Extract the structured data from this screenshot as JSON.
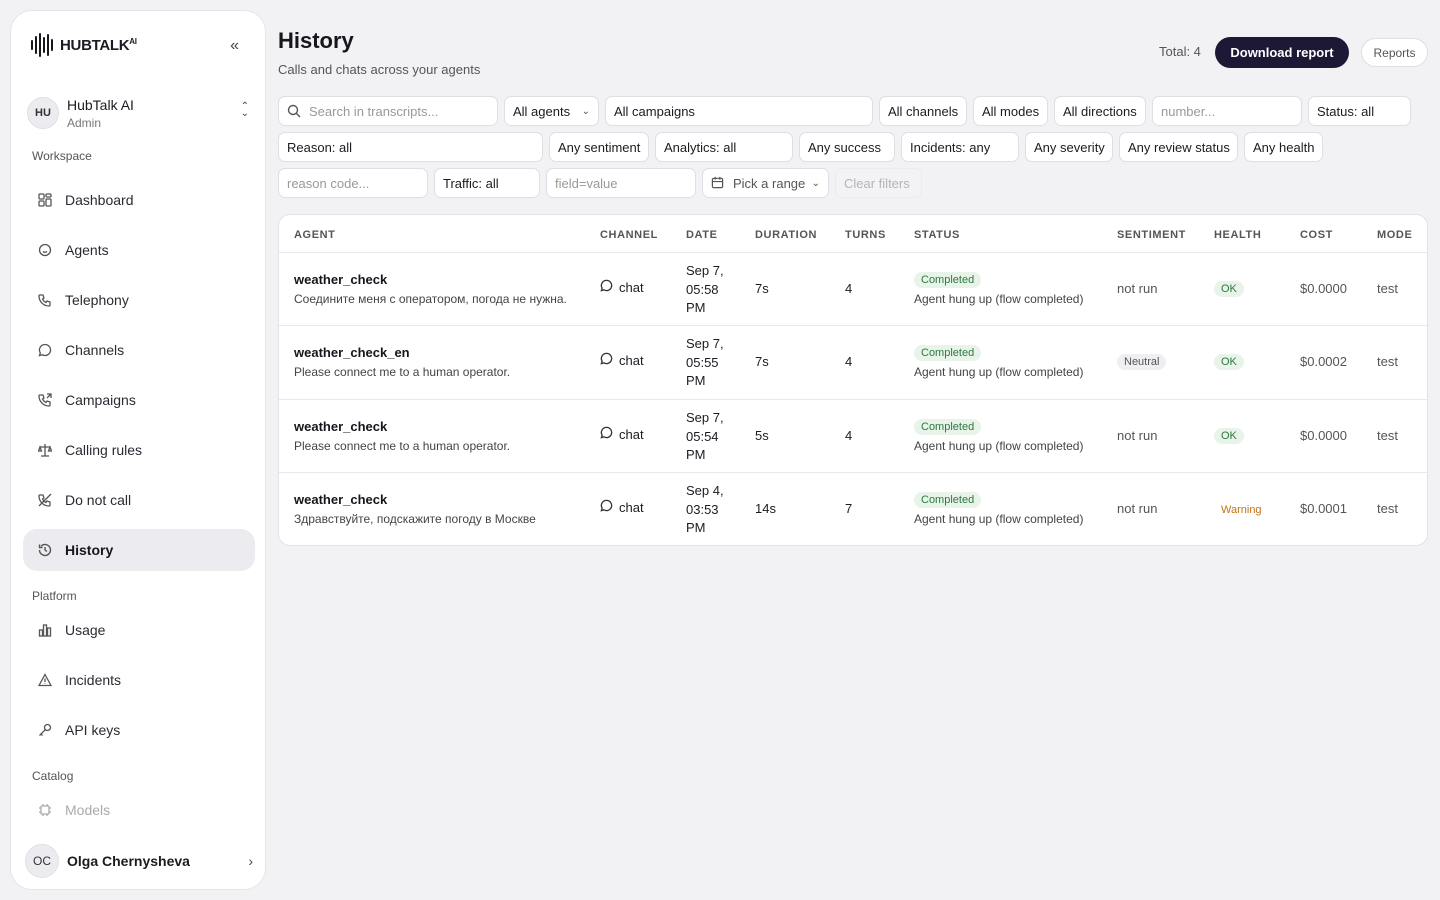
{
  "app": {
    "brand": "HUBTALK",
    "brand_sup": "AI"
  },
  "workspace": {
    "initials": "HU",
    "name": "HubTalk AI",
    "role": "Admin"
  },
  "sidebar": {
    "sections": [
      "Workspace",
      "Platform",
      "Catalog"
    ],
    "items": [
      {
        "label": "Dashboard",
        "icon": "grid-icon"
      },
      {
        "label": "Agents",
        "icon": "agent-icon"
      },
      {
        "label": "Telephony",
        "icon": "phone-icon"
      },
      {
        "label": "Channels",
        "icon": "chat-icon"
      },
      {
        "label": "Campaigns",
        "icon": "phone-outgoing-icon"
      },
      {
        "label": "Calling rules",
        "icon": "scale-icon"
      },
      {
        "label": "Do not call",
        "icon": "phone-off-icon"
      },
      {
        "label": "History",
        "icon": "history-icon",
        "active": true
      },
      {
        "label": "Usage",
        "icon": "bar-chart-icon"
      },
      {
        "label": "Incidents",
        "icon": "warning-icon"
      },
      {
        "label": "API keys",
        "icon": "key-icon"
      },
      {
        "label": "Models",
        "icon": "chip-icon",
        "disabled": true
      }
    ]
  },
  "user": {
    "initials": "OC",
    "name": "Olga Chernysheva"
  },
  "header": {
    "title": "History",
    "subtitle": "Calls and chats across your agents",
    "total": "Total: 4",
    "download_label": "Download report",
    "reports_label": "Reports"
  },
  "filters": {
    "search_placeholder": "Search in transcripts...",
    "agents": "All agents",
    "campaigns": "All campaigns",
    "channels": "All channels",
    "modes": "All modes",
    "directions": "All directions",
    "number_placeholder": "number...",
    "status": "Status: all",
    "reason": "Reason: all",
    "sentiment": "Any sentiment",
    "analytics": "Analytics: all",
    "success": "Any success",
    "incidents": "Incidents: any",
    "severity": "Any severity",
    "review": "Any review status",
    "health": "Any health",
    "reason_code_placeholder": "reason code...",
    "traffic": "Traffic: all",
    "field_placeholder": "field=value",
    "range": "Pick a range",
    "clear": "Clear filters"
  },
  "table": {
    "columns": [
      "AGENT",
      "CHANNEL",
      "DATE",
      "DURATION",
      "TURNS",
      "STATUS",
      "SENTIMENT",
      "HEALTH",
      "COST",
      "MODE"
    ],
    "rows": [
      {
        "agent": "weather_check",
        "message": "Соедините меня с оператором, погода не нужна.",
        "channel": "chat",
        "date_l1": "Sep 7,",
        "date_l2": "05:58",
        "date_l3": "PM",
        "duration": "7s",
        "turns": "4",
        "status": "Completed",
        "status_detail": "Agent hung up (flow completed)",
        "sentiment": "not run",
        "health": "OK",
        "cost": "$0.0000",
        "mode": "test"
      },
      {
        "agent": "weather_check_en",
        "message": "Please connect me to a human operator.",
        "channel": "chat",
        "date_l1": "Sep 7,",
        "date_l2": "05:55",
        "date_l3": "PM",
        "duration": "7s",
        "turns": "4",
        "status": "Completed",
        "status_detail": "Agent hung up (flow completed)",
        "sentiment": "Neutral",
        "health": "OK",
        "cost": "$0.0002",
        "mode": "test"
      },
      {
        "agent": "weather_check",
        "message": "Please connect me to a human operator.",
        "channel": "chat",
        "date_l1": "Sep 7,",
        "date_l2": "05:54",
        "date_l3": "PM",
        "duration": "5s",
        "turns": "4",
        "status": "Completed",
        "status_detail": "Agent hung up (flow completed)",
        "sentiment": "not run",
        "health": "OK",
        "cost": "$0.0000",
        "mode": "test"
      },
      {
        "agent": "weather_check",
        "message": "Здравствуйте, подскажите погоду в Москве",
        "channel": "chat",
        "date_l1": "Sep 4,",
        "date_l2": "03:53",
        "date_l3": "PM",
        "duration": "14s",
        "turns": "7",
        "status": "Completed",
        "status_detail": "Agent hung up (flow completed)",
        "sentiment": "not run",
        "health": "Warning",
        "cost": "$0.0001",
        "mode": "test"
      }
    ]
  },
  "colors": {
    "primary_button": "#1c1836",
    "ok_badge_bg": "#e8f3ea",
    "ok_badge_text": "#2c7a3c",
    "warning_text": "#c0741a"
  }
}
